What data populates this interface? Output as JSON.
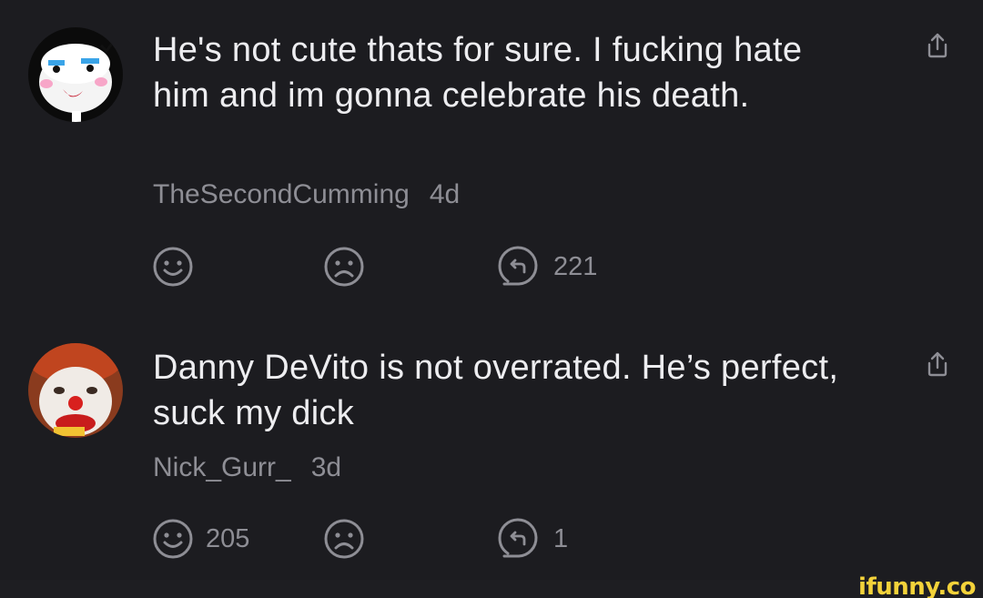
{
  "comments": [
    {
      "text": "He's not cute thats for sure. I fucking hate him and im gonna celebrate his death.",
      "username": "TheSecondCumming",
      "age": "4d",
      "smile_count": "",
      "reply_count": "221"
    },
    {
      "text": "Danny DeVito is not overrated. He’s perfect, suck my dick",
      "username": "Nick_Gurr_",
      "age": "3d",
      "smile_count": "205",
      "reply_count": "1"
    }
  ],
  "watermark": "ifunny.co",
  "colors": {
    "background": "#1c1c20",
    "text_primary": "#ededf0",
    "text_secondary": "#8e8e95",
    "watermark": "#f3d23a"
  },
  "icons": [
    "smile-icon",
    "frown-icon",
    "reply-icon",
    "share-icon"
  ]
}
